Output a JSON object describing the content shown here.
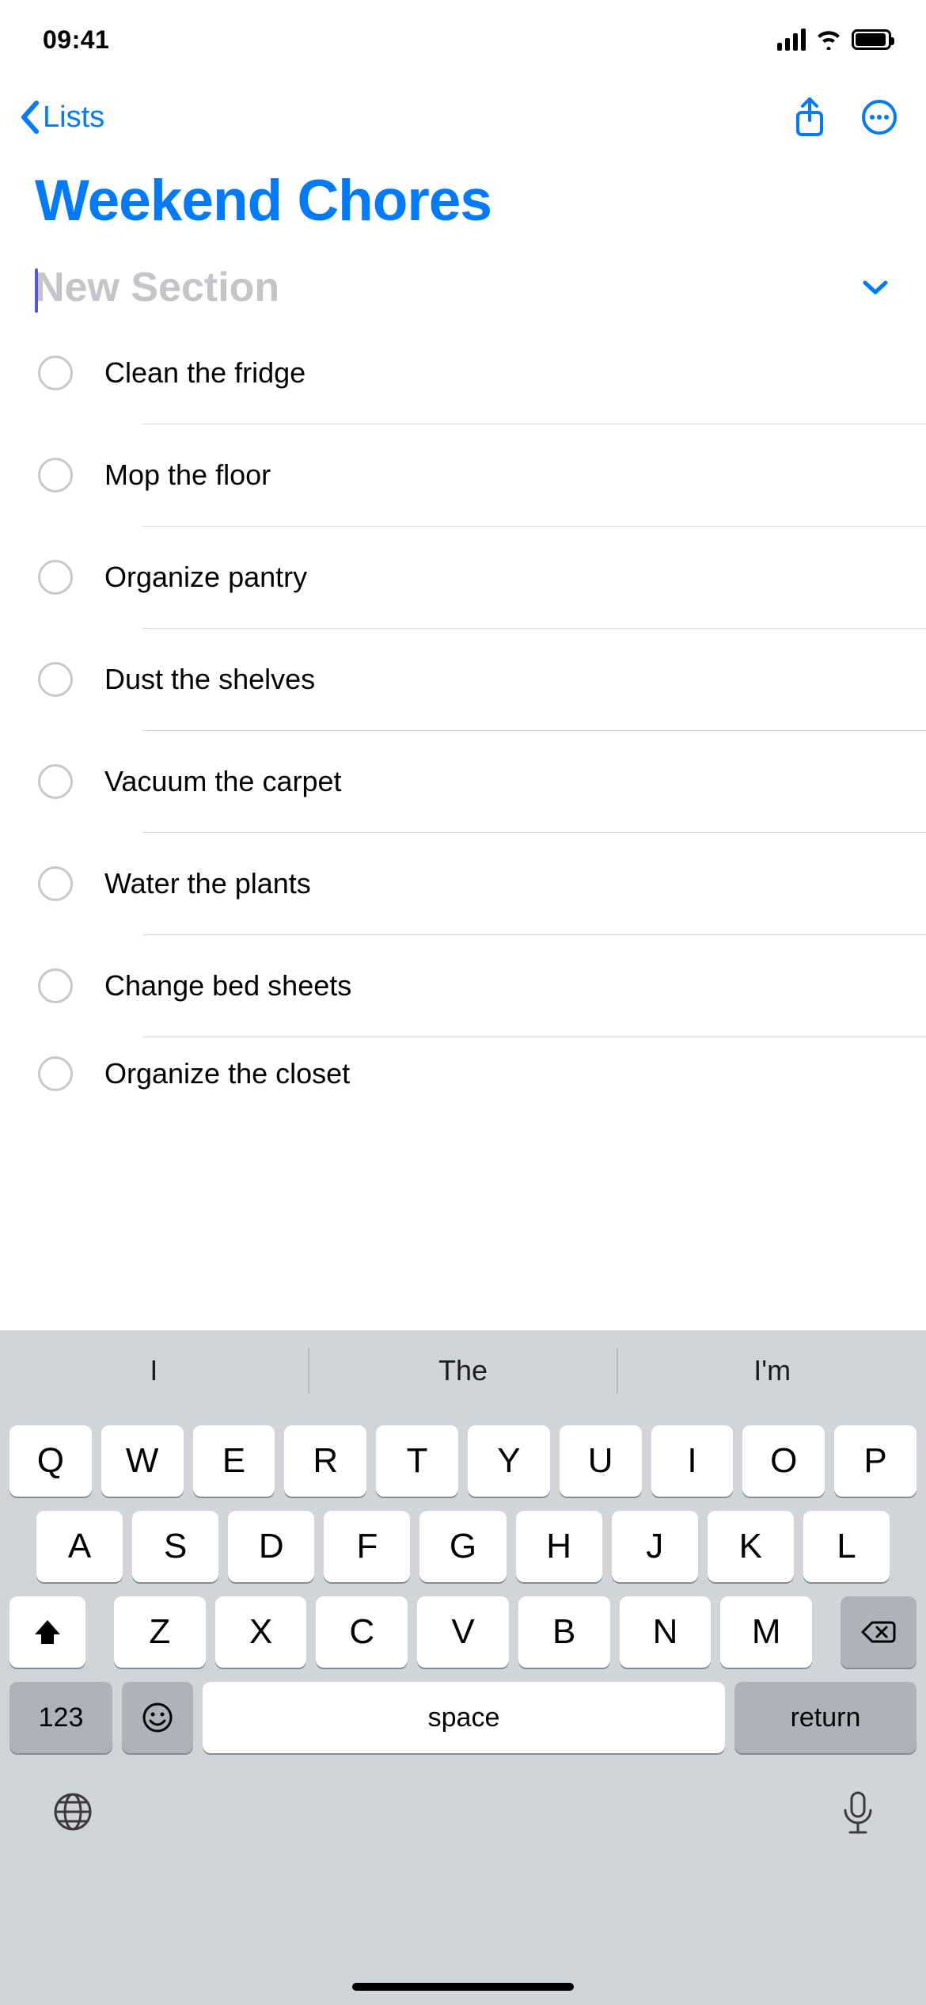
{
  "status": {
    "time": "09:41"
  },
  "nav": {
    "back_label": "Lists"
  },
  "title": "Weekend Chores",
  "section": {
    "placeholder": "New Section"
  },
  "items": [
    {
      "label": "Clean the fridge"
    },
    {
      "label": "Mop the floor"
    },
    {
      "label": "Organize pantry"
    },
    {
      "label": "Dust the shelves"
    },
    {
      "label": "Vacuum the carpet"
    },
    {
      "label": "Water the plants"
    },
    {
      "label": "Change bed sheets"
    },
    {
      "label": "Organize the closet"
    }
  ],
  "keyboard": {
    "suggestions": [
      "I",
      "The",
      "I'm"
    ],
    "row1": [
      "Q",
      "W",
      "E",
      "R",
      "T",
      "Y",
      "U",
      "I",
      "O",
      "P"
    ],
    "row2": [
      "A",
      "S",
      "D",
      "F",
      "G",
      "H",
      "J",
      "K",
      "L"
    ],
    "row3": [
      "Z",
      "X",
      "C",
      "V",
      "B",
      "N",
      "M"
    ],
    "numbers_label": "123",
    "space_label": "space",
    "return_label": "return"
  }
}
